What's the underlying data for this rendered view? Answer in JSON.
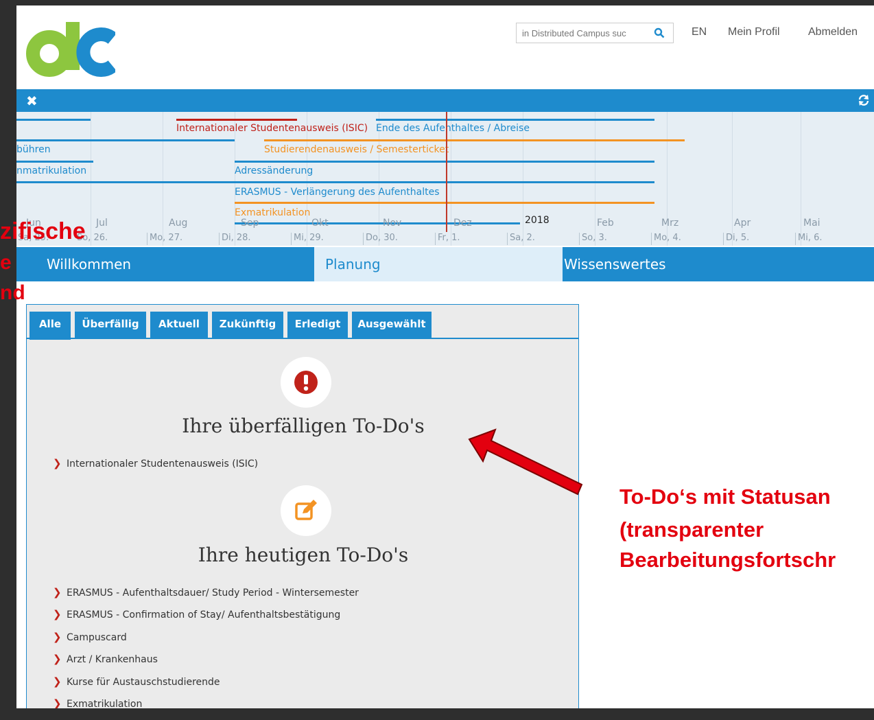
{
  "header": {
    "search_placeholder": "in Distributed Campus suc",
    "lang_link": "EN",
    "profile_link": "Mein Profil",
    "logout_link": "Abmelden"
  },
  "timeline": {
    "close_glyph": "✖",
    "events": [
      {
        "label": "Internationaler Studentenausweis (ISIC)",
        "color": "#c0221a"
      },
      {
        "label": "Ende des Aufenthaltes / Abreise",
        "color": "#1e8bcd"
      },
      {
        "label": "bühren",
        "color": "#1e8bcd"
      },
      {
        "label": "Studierendenausweis / Semesterticket",
        "color": "#f39323"
      },
      {
        "label": "nmatrikulation",
        "color": "#1e8bcd"
      },
      {
        "label": "Adressänderung",
        "color": "#1e8bcd"
      },
      {
        "label": "ERASMUS - Verlängerung des Aufenthaltes",
        "color": "#1e8bcd"
      },
      {
        "label": "Exmatrikulation",
        "color": "#f39323"
      }
    ],
    "months": [
      "Jun",
      "Jul",
      "Aug",
      "Sep",
      "Okt",
      "Nov",
      "Dez",
      "2018",
      "Feb",
      "Mrz",
      "Apr",
      "Mai"
    ],
    "days": [
      "Sa, 25.",
      "So, 26.",
      "Mo, 27.",
      "Di, 28.",
      "Mi, 29.",
      "Do, 30.",
      "Fr, 1.",
      "Sa, 2.",
      "So, 3.",
      "Mo, 4.",
      "Di, 5.",
      "Mi, 6."
    ]
  },
  "nav": {
    "items": [
      "Willkommen",
      "Planung",
      "Wissenswertes"
    ],
    "active": "Planung"
  },
  "tabs": [
    "Alle",
    "Überfällig",
    "Aktuell",
    "Zukünftig",
    "Erledigt",
    "Ausgewählt"
  ],
  "overdue": {
    "title": "Ihre überfälligen To-Do's",
    "icon": "exclamation-icon",
    "items": [
      "Internationaler Studentenausweis (ISIC)"
    ]
  },
  "today": {
    "title": "Ihre heutigen To-Do's",
    "icon": "edit-icon",
    "items": [
      "ERASMUS - Aufenthaltsdauer/ Study Period - Wintersemester",
      "ERASMUS - Confirmation of Stay/ Aufenthaltsbestätigung",
      "Campuscard",
      "Arzt / Krankenhaus",
      "Kurse für Austauschstudierende",
      "Exmatrikulation"
    ]
  },
  "annotations": {
    "left_line1": "zifische",
    "left_line2": "e",
    "left_line3": "nd",
    "right_line1": "To-Do‘s mit Statusan",
    "right_line2": "(transparenter",
    "right_line3": "Bearbeitungsfortschr"
  },
  "colors": {
    "brand_blue": "#1e8bcd",
    "overdue_red": "#c0221a",
    "orange": "#f39323",
    "logo_green": "#8dc63f",
    "annotation_red": "#e3000f"
  }
}
